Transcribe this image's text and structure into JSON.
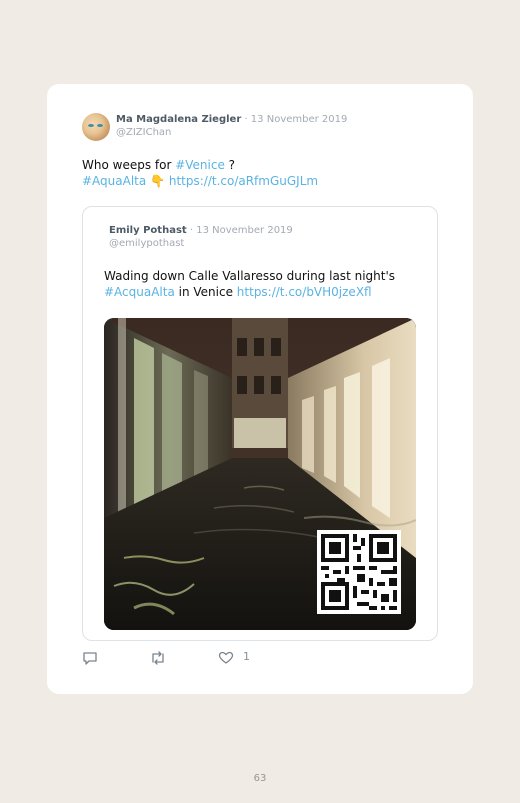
{
  "tweet": {
    "author_name": "Ma Magdalena Ziegler",
    "date": "· 13 November 2019",
    "handle": "@ZIZIChan",
    "text_prefix": "Who weeps for ",
    "hashtag_venice": "#Venice",
    "text_suffix": " ?",
    "hashtag_aquaalta": "#AquaAlta",
    "emoji": "👇",
    "link": "https://t.co/aRfmGuGJLm"
  },
  "quoted": {
    "author_name": "Emily Pothast",
    "date": "· 13 November 2019",
    "handle": "@emilypothast",
    "text_line1": "Wading down Calle Vallaresso during last night's",
    "hashtag": "#AcquaAlta",
    "text_mid": " in Venice ",
    "link": "https://t.co/bVH0jzeXfl"
  },
  "actions": {
    "likes": "1"
  },
  "page_number": "63",
  "colors": {
    "background": "#f1ebe5",
    "link": "#5ab3e3",
    "name": "#4e5a66",
    "muted": "#a3aab2"
  }
}
